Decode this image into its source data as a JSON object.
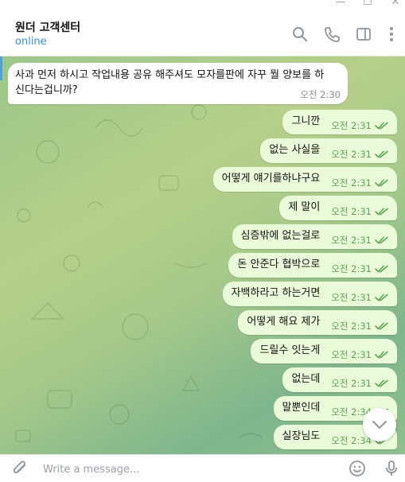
{
  "window": {
    "minimize_glyph": "—",
    "maximize_glyph": "☐",
    "close_glyph": "✕"
  },
  "header": {
    "title": "원더 고객센터",
    "status": "online",
    "icons": [
      "search-icon",
      "phone-icon",
      "sidebar-toggle-icon",
      "more-vert-icon"
    ]
  },
  "incoming": {
    "text": "사과 먼저 하시고 작업내용 공유 해주셔도 모자를판에 자꾸 뭘 양보를 하신다는겁니까?",
    "time": "오전 2:30"
  },
  "messages": [
    {
      "text": "그니깐",
      "time": "오전 2:31"
    },
    {
      "text": "없는 사실을",
      "time": "오전 2:31"
    },
    {
      "text": "어떻게 얘기를하냐구요",
      "time": "오전 2:31"
    },
    {
      "text": "제 말이",
      "time": "오전 2:31"
    },
    {
      "text": "심증밖에 없는걸로",
      "time": "오전 2:31"
    },
    {
      "text": "돈 안준다 협박으로",
      "time": "오전 2:31"
    },
    {
      "text": "자백하라고 하는거면",
      "time": "오전 2:31"
    },
    {
      "text": "어떻게 해요 제가",
      "time": "오전 2:31"
    },
    {
      "text": "드릴수 잇는게",
      "time": "오전 2:31"
    },
    {
      "text": "없는데",
      "time": "오전 2:31"
    },
    {
      "text": "말뿐인데",
      "time": "오전 2:34"
    },
    {
      "text": "실장님도",
      "time": "오전 2:34"
    }
  ],
  "composer": {
    "placeholder": "Write a message..."
  },
  "colors": {
    "accent": "#3a8fd6",
    "outgoing_bubble": "#e9fbd8",
    "check": "#5ea456"
  }
}
